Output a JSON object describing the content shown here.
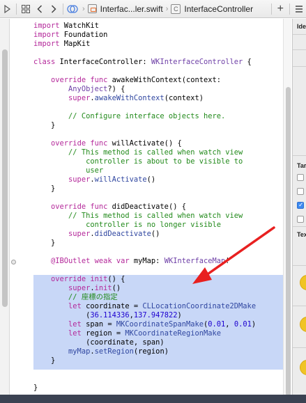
{
  "jumpbar": {
    "filename": "Interfac...ler.swift",
    "symbol": "InterfaceController",
    "add_symbol": "+",
    "right_icon": "menu-icon"
  },
  "code": {
    "lines": [
      [
        [
          "kw",
          "import"
        ],
        [
          "pl",
          " WatchKit"
        ]
      ],
      [
        [
          "kw",
          "import"
        ],
        [
          "pl",
          " Foundation"
        ]
      ],
      [
        [
          "kw",
          "import"
        ],
        [
          "pl",
          " MapKit"
        ]
      ],
      [],
      [
        [
          "kw",
          "class"
        ],
        [
          "pl",
          " InterfaceController: "
        ],
        [
          "ty",
          "WKInterfaceController"
        ],
        [
          "pl",
          " {"
        ]
      ],
      [],
      [
        [
          "pl",
          "    "
        ],
        [
          "kw",
          "override func"
        ],
        [
          "pl",
          " awakeWithContext(context:"
        ]
      ],
      [
        [
          "pl",
          "        "
        ],
        [
          "ty",
          "AnyObject"
        ],
        [
          "pl",
          "?) {"
        ]
      ],
      [
        [
          "pl",
          "        "
        ],
        [
          "kw",
          "super"
        ],
        [
          "pl",
          "."
        ],
        [
          "fn",
          "awakeWithContext"
        ],
        [
          "pl",
          "(context)"
        ]
      ],
      [],
      [
        [
          "pl",
          "        "
        ],
        [
          "cm",
          "// Configure interface objects here."
        ]
      ],
      [
        [
          "pl",
          "    }"
        ]
      ],
      [],
      [
        [
          "pl",
          "    "
        ],
        [
          "kw",
          "override func"
        ],
        [
          "pl",
          " willActivate() {"
        ]
      ],
      [
        [
          "pl",
          "        "
        ],
        [
          "cm",
          "// This method is called when watch view"
        ]
      ],
      [
        [
          "pl",
          "            "
        ],
        [
          "cm",
          "controller is about to be visible to"
        ]
      ],
      [
        [
          "pl",
          "            "
        ],
        [
          "cm",
          "user"
        ]
      ],
      [
        [
          "pl",
          "        "
        ],
        [
          "kw",
          "super"
        ],
        [
          "pl",
          "."
        ],
        [
          "fn",
          "willActivate"
        ],
        [
          "pl",
          "()"
        ]
      ],
      [
        [
          "pl",
          "    }"
        ]
      ],
      [],
      [
        [
          "pl",
          "    "
        ],
        [
          "kw",
          "override func"
        ],
        [
          "pl",
          " didDeactivate() {"
        ]
      ],
      [
        [
          "pl",
          "        "
        ],
        [
          "cm",
          "// This method is called when watch view"
        ]
      ],
      [
        [
          "pl",
          "            "
        ],
        [
          "cm",
          "controller is no longer visible"
        ]
      ],
      [
        [
          "pl",
          "        "
        ],
        [
          "kw",
          "super"
        ],
        [
          "pl",
          "."
        ],
        [
          "fn",
          "didDeactivate"
        ],
        [
          "pl",
          "()"
        ]
      ],
      [
        [
          "pl",
          "    }"
        ]
      ],
      [],
      [
        [
          "pl",
          "    "
        ],
        [
          "kw",
          "@IBOutlet weak var"
        ],
        [
          "pl",
          " myMap: "
        ],
        [
          "ty",
          "WKInterfaceMap"
        ],
        [
          "pl",
          "!"
        ]
      ],
      [],
      [
        [
          "pl",
          "    "
        ],
        [
          "kw",
          "override"
        ],
        [
          "pl",
          " "
        ],
        [
          "kw",
          "init"
        ],
        [
          "pl",
          "() {"
        ]
      ],
      [
        [
          "pl",
          "        "
        ],
        [
          "kw",
          "super"
        ],
        [
          "pl",
          "."
        ],
        [
          "kw",
          "init"
        ],
        [
          "pl",
          "()"
        ]
      ],
      [
        [
          "pl",
          "        "
        ],
        [
          "cm",
          "// 座標の指定"
        ]
      ],
      [
        [
          "pl",
          "        "
        ],
        [
          "kw",
          "let"
        ],
        [
          "pl",
          " coordinate = "
        ],
        [
          "fn",
          "CLLocationCoordinate2DMake"
        ]
      ],
      [
        [
          "pl",
          "            ("
        ],
        [
          "nm",
          "36.114336"
        ],
        [
          "pl",
          ","
        ],
        [
          "nm",
          "137.947822"
        ],
        [
          "pl",
          ")"
        ]
      ],
      [
        [
          "pl",
          "        "
        ],
        [
          "kw",
          "let"
        ],
        [
          "pl",
          " span = "
        ],
        [
          "fn",
          "MKCoordinateSpanMake"
        ],
        [
          "pl",
          "("
        ],
        [
          "nm",
          "0.01"
        ],
        [
          "pl",
          ", "
        ],
        [
          "nm",
          "0.01"
        ],
        [
          "pl",
          ")"
        ]
      ],
      [
        [
          "pl",
          "        "
        ],
        [
          "kw",
          "let"
        ],
        [
          "pl",
          " region = "
        ],
        [
          "fn",
          "MKCoordinateRegionMake"
        ]
      ],
      [
        [
          "pl",
          "            (coordinate, span)"
        ]
      ],
      [
        [
          "pl",
          "        "
        ],
        [
          "fn",
          "myMap"
        ],
        [
          "pl",
          "."
        ],
        [
          "fn",
          "setRegion"
        ],
        [
          "pl",
          "(region)"
        ]
      ],
      [
        [
          "pl",
          "    }"
        ]
      ],
      [],
      [],
      [
        [
          "pl",
          "}"
        ]
      ]
    ]
  },
  "inspector": {
    "label_identity": "Ide",
    "label_target": "Tar",
    "label_text": "Tex",
    "checkboxes": [
      false,
      false,
      true,
      false
    ]
  },
  "colors": {
    "keyword": "#b4289a",
    "comment": "#228a1b",
    "type": "#6f41a7",
    "function": "#2f46a0",
    "number": "#1c00cf",
    "highlight": "#c8d7f7",
    "arrow": "#e82020"
  }
}
